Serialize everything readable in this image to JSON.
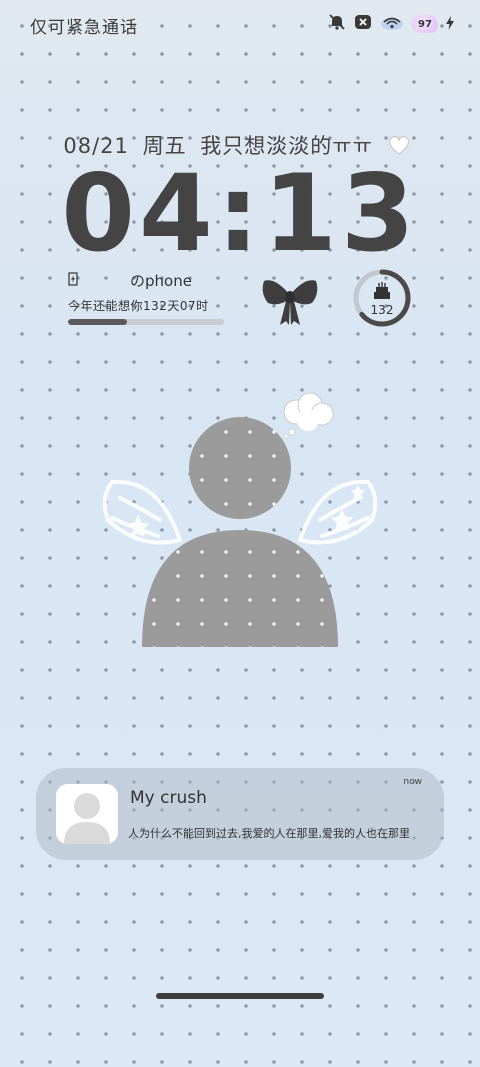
{
  "status_bar": {
    "carrier_text": "仅可紧急通话",
    "battery_level": "97",
    "icons": [
      "mute-icon",
      "close-box-icon",
      "wifi-icon",
      "charging-bolt-icon"
    ]
  },
  "lockscreen": {
    "date": "08/21",
    "weekday": "周五",
    "mood_text": "我只想淡淡的ㅠㅠ",
    "time": "04:13"
  },
  "phone_widget": {
    "label": "のphone",
    "countdown": "今年还能想你132天07时",
    "progress_fraction": 0.38
  },
  "birthday_widget": {
    "days": "132",
    "ring_fraction": 0.64
  },
  "notification": {
    "title": "My crush",
    "time": "now",
    "body": "人为什么不能回到过去,我爱的人在那里,爱我的人也在那里"
  },
  "colors": {
    "background": "#dbe6f1",
    "text": "#444444",
    "avatar_gray": "#9b9b9b",
    "notification_bg": "#b8c3cf"
  }
}
